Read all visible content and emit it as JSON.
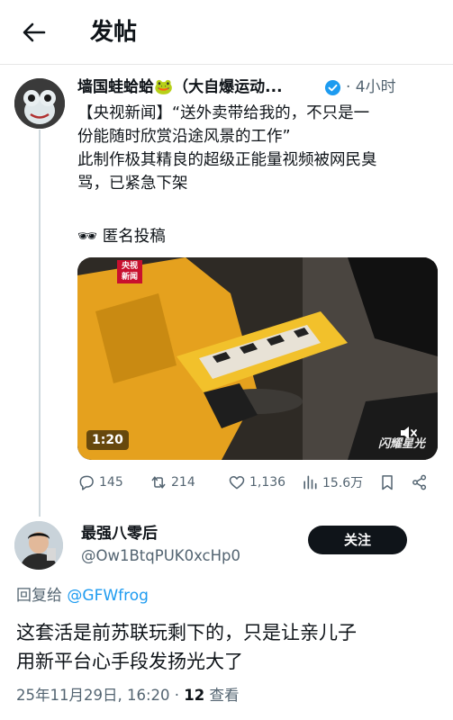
{
  "header": {
    "title": "发帖"
  },
  "parent_tweet": {
    "author_name": "墙国蛙蛤蛤🐸（大自爆运动...",
    "time": "· 4小时",
    "lines": [
      "【央视新闻】“送外卖带给我的，不只是一",
      "份能随时欣赏沿途风景的工作”",
      "此制作极其精良的超级正能量视频被网民臭",
      "骂，已紧急下架",
      "🕶 匿名投稿"
    ],
    "media": {
      "badge": "央视\n新闻",
      "duration": "1:20",
      "watermark": "闪耀星光"
    },
    "actions": {
      "replies": "145",
      "retweets": "214",
      "likes": "1,136",
      "views": "15.6万"
    }
  },
  "reply": {
    "author_name": "最强八零后",
    "handle": "@Ow1BtqPUK0xcHp0",
    "follow_label": "关注",
    "reply_to_prefix": "回复给",
    "reply_to_mention": "@GFWfrog",
    "lines": [
      "这套活是前苏联玩剩下的，只是让亲儿子",
      "用新平台心手段发扬光大了"
    ],
    "date": "25年11月29日, 16:20 · ",
    "view_count": "12",
    "view_label": " 查看"
  },
  "colors": {
    "accent": "#1d9bf0",
    "muted": "#536471",
    "text": "#0f1419"
  }
}
